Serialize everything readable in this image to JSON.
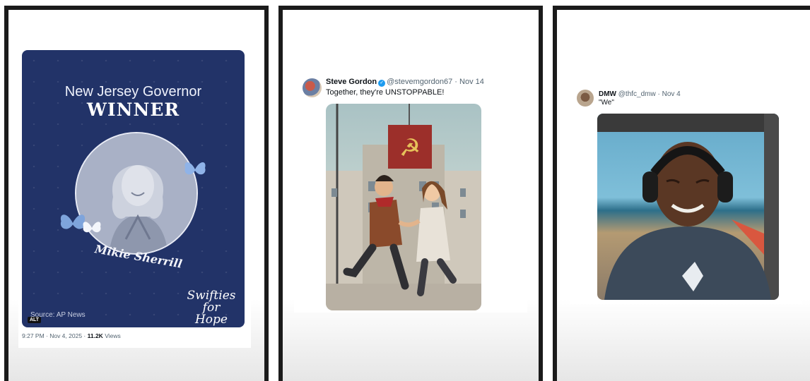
{
  "panels": [
    {
      "graphic": {
        "title_line": "New Jersey Governor",
        "headline": "WINNER",
        "name": "Mikie Sherrill",
        "source": "Source: AP News",
        "logo_text": "Swifties for Hope",
        "alt_badge": "ALT"
      },
      "meta": {
        "time": "9:27 PM · Nov 4, 2025 · ",
        "views_count": "11.2K",
        "views_label": " Views"
      }
    },
    {
      "author_name": "Steve Gordon",
      "verified_icon": "verified-badge-icon",
      "handle": "@stevemgordon67 · Nov 14",
      "text": "Together, they're UNSTOPPABLE!",
      "image_icon": "cartoon-couple-running-image"
    },
    {
      "author_name": "DMW",
      "handle": "@thfc_dmw · Nov 4",
      "text": "\"We\"",
      "image_icon": "smiling-man-headphones-photo"
    }
  ],
  "colors": {
    "frame": "#1b1b1b",
    "graphic_bg": "#223368",
    "butterfly": "#8fb3e8",
    "verified": "#1d9bf0",
    "secondary_text": "#536471"
  }
}
